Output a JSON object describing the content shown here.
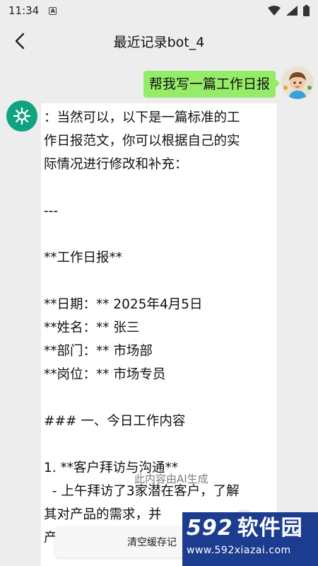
{
  "status_bar": {
    "time": "11:34",
    "app_icon": "A"
  },
  "app_bar": {
    "title": "最近记录bot_4"
  },
  "user_message": {
    "text": "帮我写一篇工作日报"
  },
  "bot_message": {
    "lines": [
      "：当然可以，以下是一篇标准的工",
      "作日报范文，你可以根据自己的实",
      "际情况进行修改和补充：",
      "",
      "---",
      "",
      "**工作日报**",
      "",
      "**日期：** 2025年4月5日",
      "**姓名：** 张三",
      "**部门：** 市场部",
      "**岗位：** 市场专员",
      "",
      "### 一、今日工作内容",
      "",
      "1. **客户拜访与沟通**",
      "  - 上午拜访了3家潜在客户，了解",
      "其对产品的需求，并",
      "产"
    ]
  },
  "ai_note": "此内容由AI生成",
  "clear_button": {
    "label": "清空缓存记"
  },
  "watermark": {
    "brand_num": "592",
    "brand_text": "软件园",
    "url": "www.592xiazai.com"
  },
  "colors": {
    "user_bubble": "#95ec69",
    "bot_avatar": "#10a37f",
    "watermark_bg": "#1c3d8f"
  }
}
